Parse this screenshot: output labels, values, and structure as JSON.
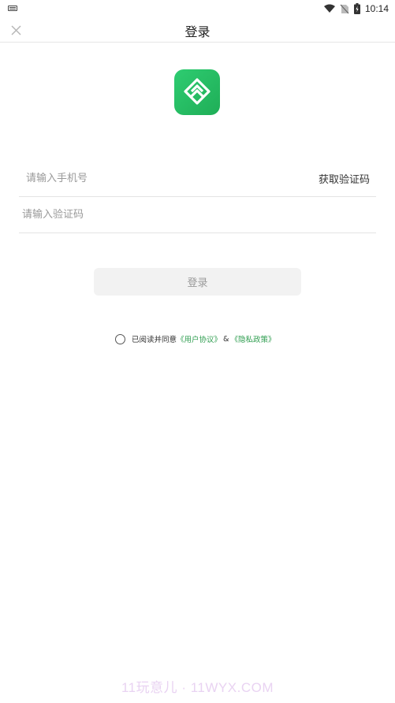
{
  "status_bar": {
    "time": "10:14",
    "icons": [
      "keyboard-icon",
      "wifi-icon",
      "no-sim-icon",
      "battery-charging-icon"
    ]
  },
  "nav": {
    "title": "登录",
    "close_icon": "close-icon"
  },
  "logo": {
    "icon": "app-logo-icon",
    "color": "#27c064"
  },
  "form": {
    "phone_placeholder": "请输入手机号",
    "get_code_label": "获取验证码",
    "code_placeholder": "请输入验证码",
    "login_label": "登录"
  },
  "agreement": {
    "prefix": "已阅读并同意",
    "user_agreement": "《用户协议》",
    "amp": "&",
    "privacy_policy": "《隐私政策》",
    "link_color": "#2e9d4f"
  },
  "watermark": "11玩意儿 · 11WYX.COM"
}
